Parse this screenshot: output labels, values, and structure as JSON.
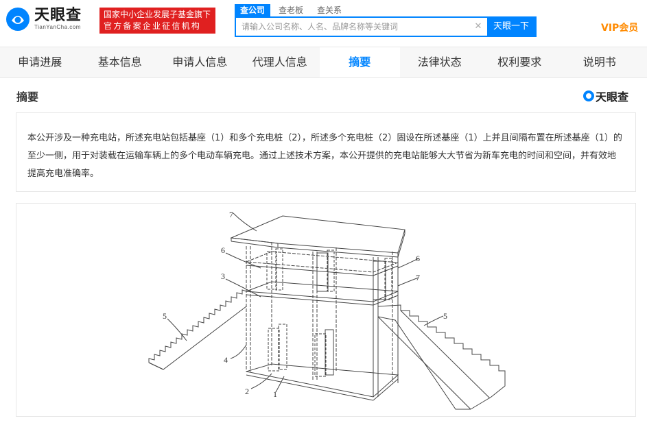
{
  "header": {
    "logo_cn": "天眼查",
    "logo_en": "TianYanCha.com",
    "gov_badge_line1": "国家中小企业发展子基金旗下",
    "gov_badge_line2": "官方备案企业征信机构",
    "search_tabs": [
      "查公司",
      "查老板",
      "查关系"
    ],
    "search_placeholder": "请输入公司名称、人名、品牌名称等关键词",
    "search_button": "天眼一下",
    "vip_label": "VIP会员"
  },
  "tabs": [
    "申请进展",
    "基本信息",
    "申请人信息",
    "代理人信息",
    "摘要",
    "法律状态",
    "权利要求",
    "说明书"
  ],
  "active_tab": "摘要",
  "section": {
    "title": "摘要",
    "watermark": "天眼查",
    "abstract_text": "本公开涉及一种充电站，所述充电站包括基座（1）和多个充电桩（2），所述多个充电桩（2）固设在所述基座（1）上并且间隔布置在所述基座（1）的至少一侧，用于对装载在运输车辆上的多个电动车辆充电。通过上述技术方案，本公开提供的充电站能够大大节省为新车充电的时间和空间，并有效地提高充电准确率。"
  },
  "figure_labels": [
    "7",
    "6",
    "3",
    "5",
    "4",
    "2",
    "1",
    "6",
    "7",
    "5"
  ],
  "colors": {
    "accent": "#0084ff",
    "badge": "#e02020",
    "vip": "#ff8a00"
  }
}
